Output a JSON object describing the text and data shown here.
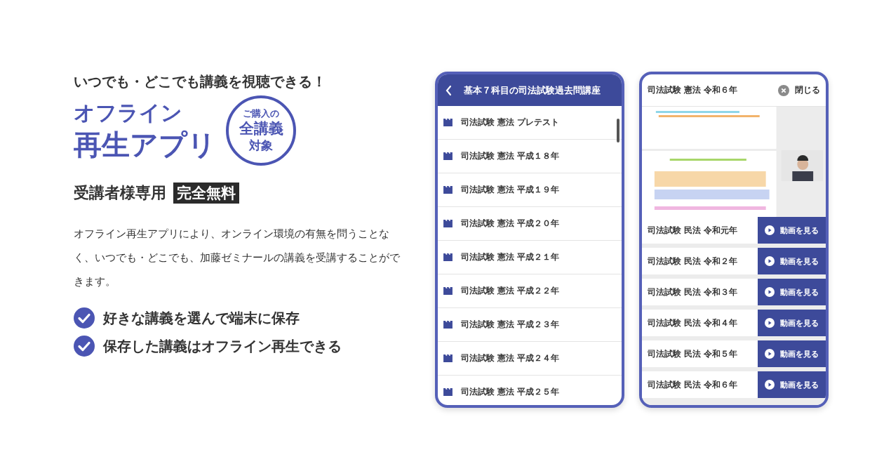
{
  "promo": {
    "tagline": "いつでも・どこでも講義を視聴できる！",
    "title_lines": [
      "オフライン",
      "再生アプリ"
    ],
    "badge_lines": [
      "ご購入の",
      "全講義",
      "対象"
    ],
    "audience": "受講者様専用",
    "price_tag": "完全無料",
    "description": "オフライン再生アプリにより、オンライン環境の有無を問うことなく、いつでも・どこでも、加藤ゼミナールの講義を受講することができます。",
    "features": [
      "好きな講義を選んで端末に保存",
      "保存した講義はオフライン再生できる"
    ]
  },
  "list_screen": {
    "title": "基本７科目の司法試験過去問講座",
    "items": [
      "司法試験 憲法 プレテスト",
      "司法試験 憲法 平成１８年",
      "司法試験 憲法 平成１９年",
      "司法試験 憲法 平成２０年",
      "司法試験 憲法 平成２１年",
      "司法試験 憲法 平成２２年",
      "司法試験 憲法 平成２３年",
      "司法試験 憲法 平成２４年",
      "司法試験 憲法 平成２５年"
    ]
  },
  "player_screen": {
    "title": "司法試験 憲法 令和６年",
    "close_label": "閉じる",
    "items": [
      {
        "title": "司法試験 民法 令和元年",
        "button": "動画を見る"
      },
      {
        "title": "司法試験 民法 令和２年",
        "button": "動画を見る"
      },
      {
        "title": "司法試験 民法 令和３年",
        "button": "動画を見る"
      },
      {
        "title": "司法試験 民法 令和４年",
        "button": "動画を見る"
      },
      {
        "title": "司法試験 民法 令和５年",
        "button": "動画を見る"
      },
      {
        "title": "司法試験 民法 令和６年",
        "button": "動画を見る"
      }
    ]
  }
}
